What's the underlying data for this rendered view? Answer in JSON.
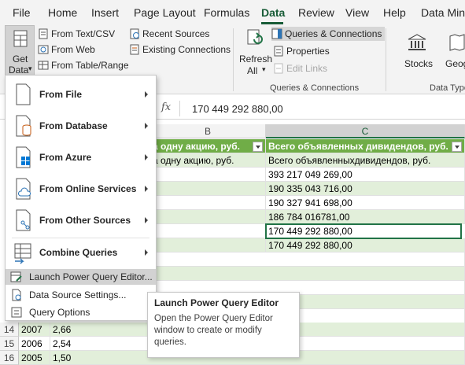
{
  "ribbon_tabs": [
    "File",
    "Home",
    "Insert",
    "Page Layout",
    "Formulas",
    "Data",
    "Review",
    "View",
    "Help",
    "Data Mini"
  ],
  "active_tab": "Data",
  "get_data": {
    "line1": "Get",
    "line2": "Data",
    "arrow": "▾"
  },
  "get_transform": {
    "from_text_csv": "From Text/CSV",
    "from_web": "From Web",
    "from_table_range": "From Table/Range",
    "recent_sources": "Recent Sources",
    "existing_connections": "Existing Connections"
  },
  "refresh": {
    "line1": "Refresh",
    "line2": "All",
    "arrow": "▾"
  },
  "queries_group": {
    "queries_connections": "Queries & Connections",
    "properties": "Properties",
    "edit_links": "Edit Links",
    "label": "Queries & Connections"
  },
  "data_types": {
    "stocks": "Stocks",
    "geography": "Geog",
    "label": "Data Types"
  },
  "formula_bar": {
    "fx": "fx",
    "value": "170 449 292 880,00"
  },
  "columns": {
    "b": "B",
    "c": "C"
  },
  "header_row": {
    "b": "а одну акцию, руб.",
    "c": "Всего объявленных дивидендов, руб."
  },
  "row2": {
    "b": "а одну акцию, руб.",
    "c": "Всего объявленныхдивидендов, руб."
  },
  "c_values": [
    "393 217 049 269,00",
    "190 335 043 716,00",
    "190 327 941 698,00",
    "186 784 016781,00",
    "170 449 292 880,00",
    "170 449 292 880,00"
  ],
  "visible_rows": [
    {
      "num": "14",
      "year": "2007",
      "value": "2,66"
    },
    {
      "num": "15",
      "year": "2006",
      "value": "2,54"
    },
    {
      "num": "16",
      "year": "2005",
      "value": "1,50"
    }
  ],
  "menu": {
    "from_file": "From File",
    "from_database": "From Database",
    "from_azure": "From Azure",
    "from_online_services": "From Online Services",
    "from_other_sources": "From Other Sources",
    "combine_queries": "Combine Queries",
    "launch_pq": "Launch Power Query Editor...",
    "data_source_settings": "Data Source Settings...",
    "query_options": "Query Options"
  },
  "tooltip": {
    "title": "Launch Power Query Editor",
    "body": "Open the Power Query Editor window to create or modify queries."
  },
  "colors": {
    "accent": "#185c37",
    "table_header": "#70ad47",
    "band": "#e2efda",
    "selection": "#217346"
  }
}
